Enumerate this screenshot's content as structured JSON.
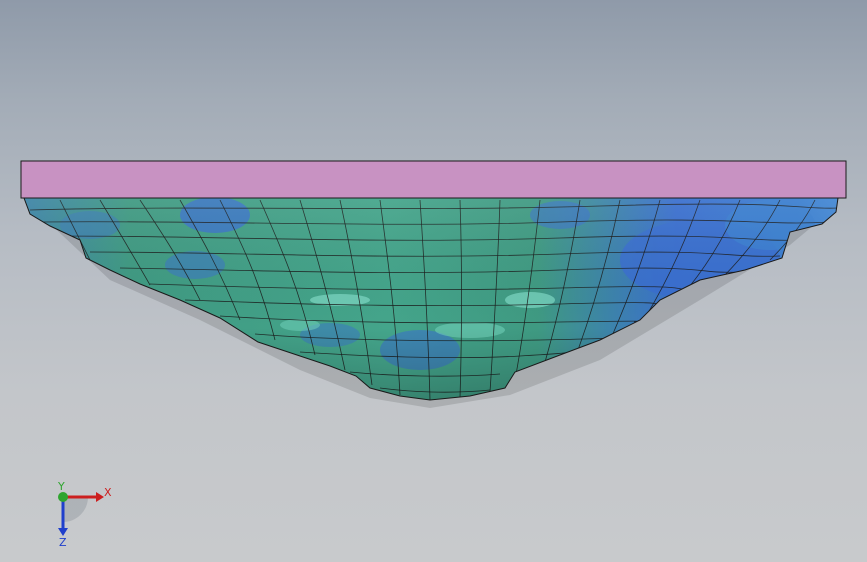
{
  "viewport": {
    "background_top": "#8f9aa9",
    "background_bottom": "#c8cacc"
  },
  "model": {
    "plate_color": "#c892c2",
    "surface_green": "#3f9a82",
    "surface_blue": "#3a6fcf",
    "mesh_color": "#1a1a1a"
  },
  "triad": {
    "x_label": "X",
    "y_label": "Y",
    "z_label": "Z",
    "x_color": "#cc1f1f",
    "y_color": "#2fa52f",
    "z_color": "#1f3fcc"
  }
}
